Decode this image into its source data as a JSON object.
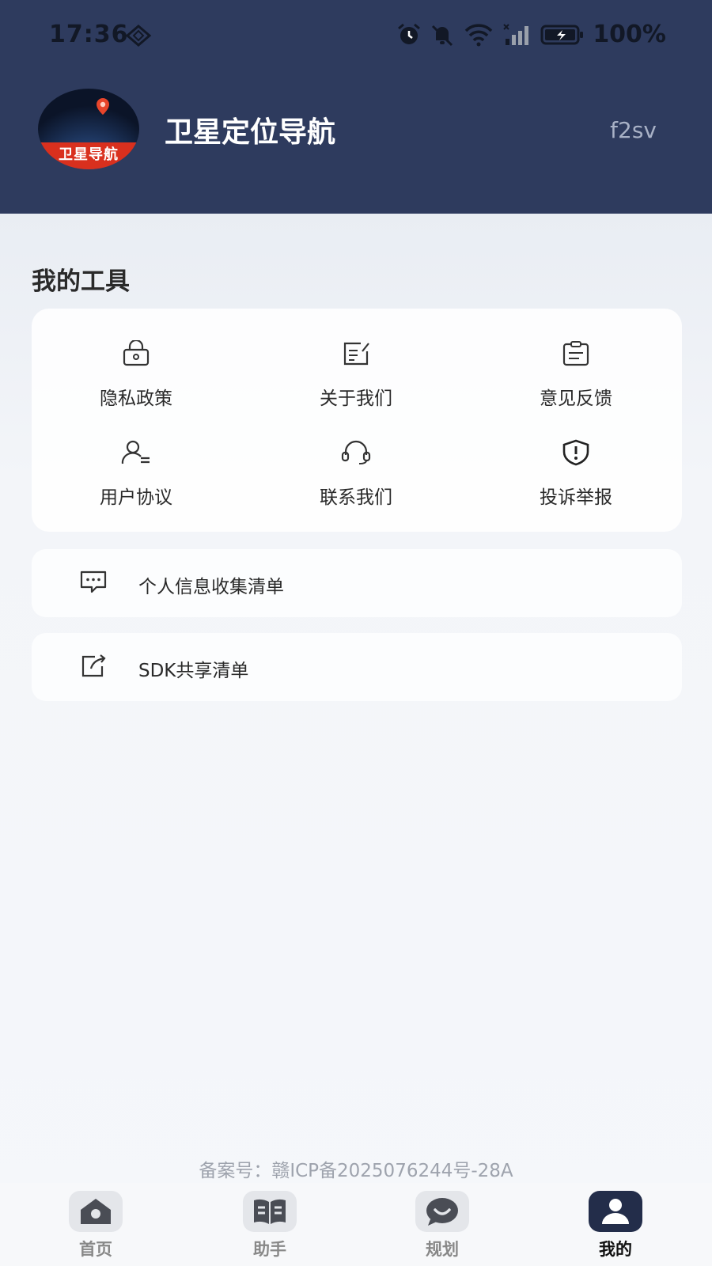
{
  "status_bar": {
    "time": "17:36",
    "battery": "100%"
  },
  "header": {
    "app_logo_text": "卫星导航",
    "app_title": "卫星定位导航",
    "user_code": "f2sv"
  },
  "tools": {
    "title": "我的工具",
    "items": [
      {
        "label": "隐私政策",
        "icon": "lock-icon"
      },
      {
        "label": "关于我们",
        "icon": "edit-note-icon"
      },
      {
        "label": "意见反馈",
        "icon": "clipboard-icon"
      },
      {
        "label": "用户协议",
        "icon": "user-list-icon"
      },
      {
        "label": "联系我们",
        "icon": "headset-icon"
      },
      {
        "label": "投诉举报",
        "icon": "shield-alert-icon"
      }
    ]
  },
  "list": [
    {
      "label": "个人信息收集清单",
      "icon": "message-dots-icon"
    },
    {
      "label": "SDK共享清单",
      "icon": "share-box-icon"
    }
  ],
  "footer": {
    "icp": "备案号：赣ICP备2025076244号-28A"
  },
  "tabbar": {
    "active": "我的",
    "items": [
      {
        "label": "首页",
        "icon": "home-icon"
      },
      {
        "label": "助手",
        "icon": "book-icon"
      },
      {
        "label": "规划",
        "icon": "chat-bubble-icon"
      },
      {
        "label": "我的",
        "icon": "user-icon"
      }
    ]
  },
  "colors": {
    "header_bg": "#2e3b5e",
    "active_tab": "#232d4a",
    "logo_banner": "#d9301e"
  }
}
